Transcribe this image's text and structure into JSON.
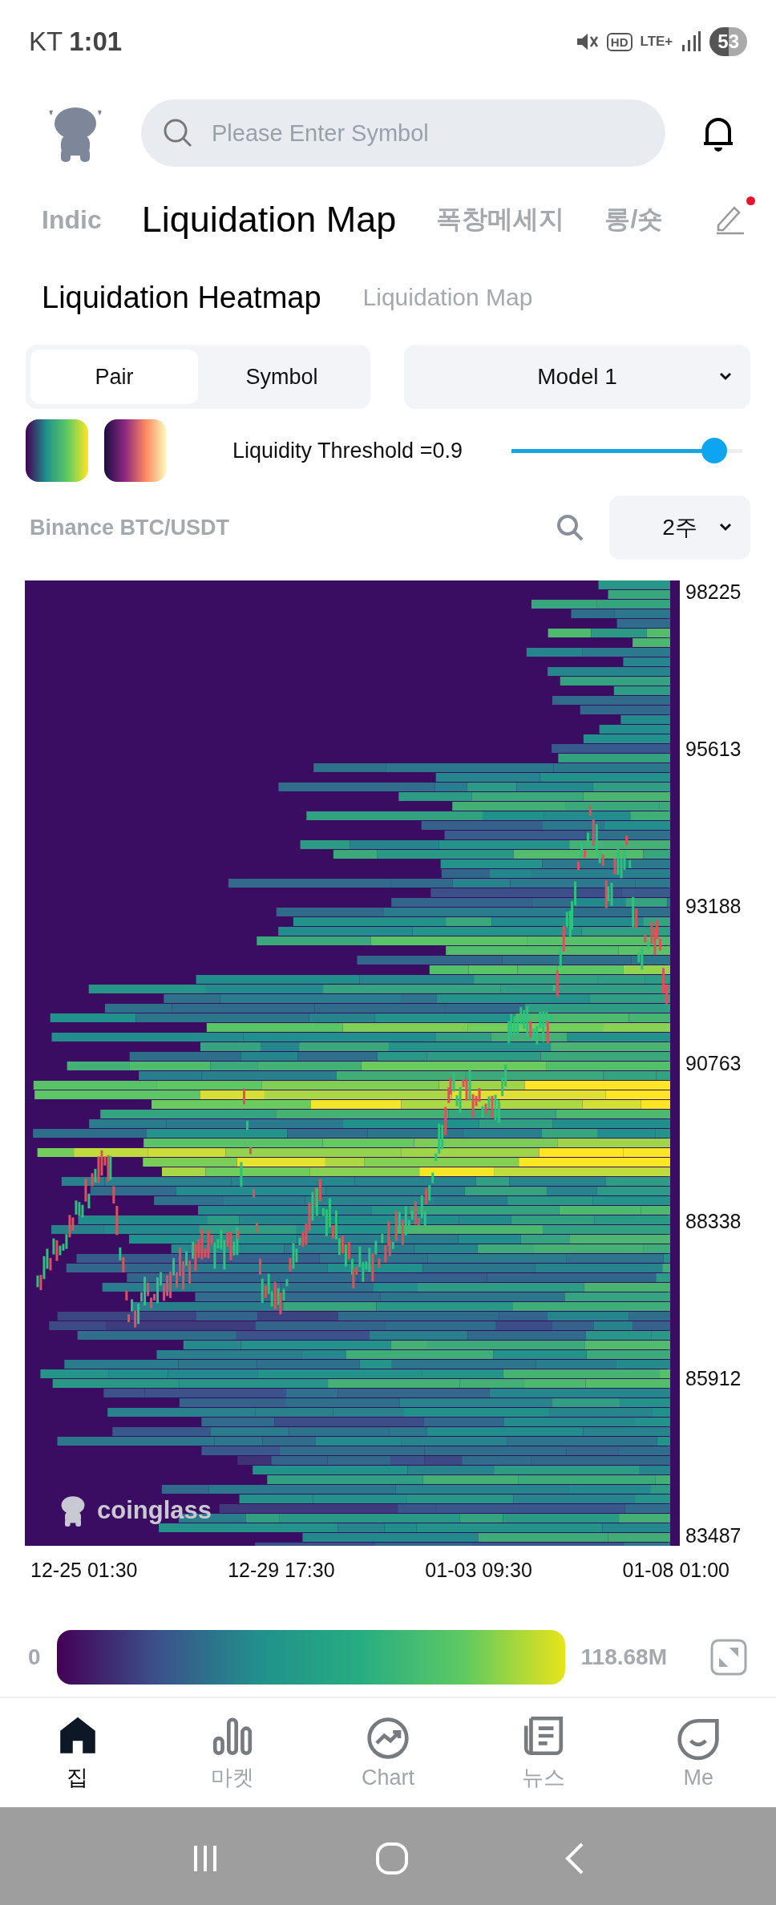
{
  "status_bar": {
    "carrier": "KT",
    "time": "1:01",
    "hd": "HD",
    "network": "LTE+",
    "battery": "53"
  },
  "header": {
    "search": {
      "placeholder": "Please Enter Symbol"
    }
  },
  "top_tabs": [
    {
      "label": "Indic",
      "selected": false
    },
    {
      "label": "Liquidation Map",
      "selected": true
    },
    {
      "label": "폭창메세지",
      "selected": false
    },
    {
      "label": "롱/숏",
      "selected": false
    }
  ],
  "edit": {
    "badge": true
  },
  "sub_tabs": [
    {
      "label": "Liquidation Heatmap",
      "selected": true
    },
    {
      "label": "Liquidation Map",
      "selected": false
    }
  ],
  "segmented": [
    {
      "label": "Pair",
      "selected": true
    },
    {
      "label": "Symbol",
      "selected": false
    }
  ],
  "model_select": {
    "value": "Model 1"
  },
  "threshold": {
    "label": "Liquidity Threshold =0.9",
    "level": 0.88
  },
  "pair_label": "Binance BTC/USDT",
  "range_select": {
    "value": "2주"
  },
  "heatmap": {
    "watermark": "coinglass",
    "y_labels": [
      "98225",
      "95613",
      "93188",
      "90763",
      "88338",
      "85912",
      "83487"
    ],
    "x_labels": [
      "12-25 01:30",
      "12-29 17:30",
      "01-03 09:30",
      "01-08 01:00"
    ]
  },
  "legend": {
    "min": "0",
    "max": "118.68M"
  },
  "bottom_nav": [
    {
      "label": "집",
      "kind": "home",
      "selected": true
    },
    {
      "label": "마켓",
      "kind": "market",
      "selected": false
    },
    {
      "label": "Chart",
      "kind": "chart",
      "selected": false
    },
    {
      "label": "뉴스",
      "kind": "news",
      "selected": false
    },
    {
      "label": "Me",
      "kind": "me",
      "selected": false
    }
  ]
}
